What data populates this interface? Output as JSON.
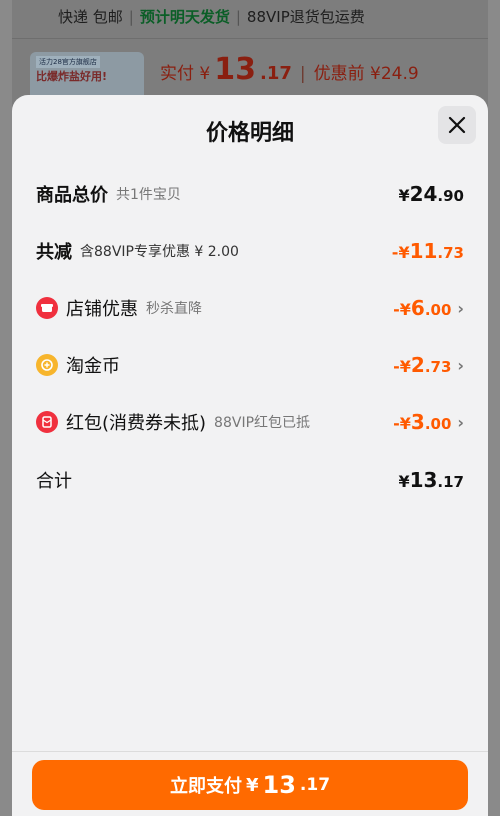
{
  "background": {
    "shipping": {
      "express": "快递 包邮",
      "divider": "|",
      "delivery": "预计明天发货",
      "return": "88VIP退货包运费"
    },
    "product_thumb": {
      "shop": "活力28官方旗舰店",
      "slogan": "比爆炸盐好用!"
    },
    "price": {
      "actual_label": "实付 ¥",
      "actual_int": "13",
      "actual_dec": ".17",
      "bar": "|",
      "before_label": "优惠前 ¥24.9"
    }
  },
  "sheet": {
    "title": "价格明细",
    "rows": {
      "total": {
        "label": "商品总价",
        "sub": "共1件宝贝",
        "cur": "¥",
        "int": "24",
        "dec": ".90"
      },
      "reduce": {
        "label": "共减",
        "sub": "含88VIP专享优惠 ¥ 2.00",
        "cur": "-¥",
        "int": "11",
        "dec": ".73"
      },
      "shop": {
        "label": "店铺优惠",
        "sub": "秒杀直降",
        "cur": "-¥",
        "int": "6",
        "dec": ".00",
        "icon": "shop-icon"
      },
      "coin": {
        "label": "淘金币",
        "sub": "",
        "cur": "-¥",
        "int": "2",
        "dec": ".73",
        "icon": "coin-icon"
      },
      "redpack": {
        "label": "红包(消费券未抵)",
        "sub": "88VIP红包已抵",
        "cur": "-¥",
        "int": "3",
        "dec": ".00",
        "icon": "red-envelope-icon"
      },
      "sum": {
        "label": "合计",
        "cur": "¥",
        "int": "13",
        "dec": ".17"
      }
    },
    "pay_button": {
      "label": "立即支付",
      "cur": "¥",
      "int": "13",
      "dec": ".17"
    },
    "colors": {
      "accent": "#ff6a00",
      "discount": "#ff5a00",
      "sheet_bg": "#f2f2f3"
    }
  }
}
